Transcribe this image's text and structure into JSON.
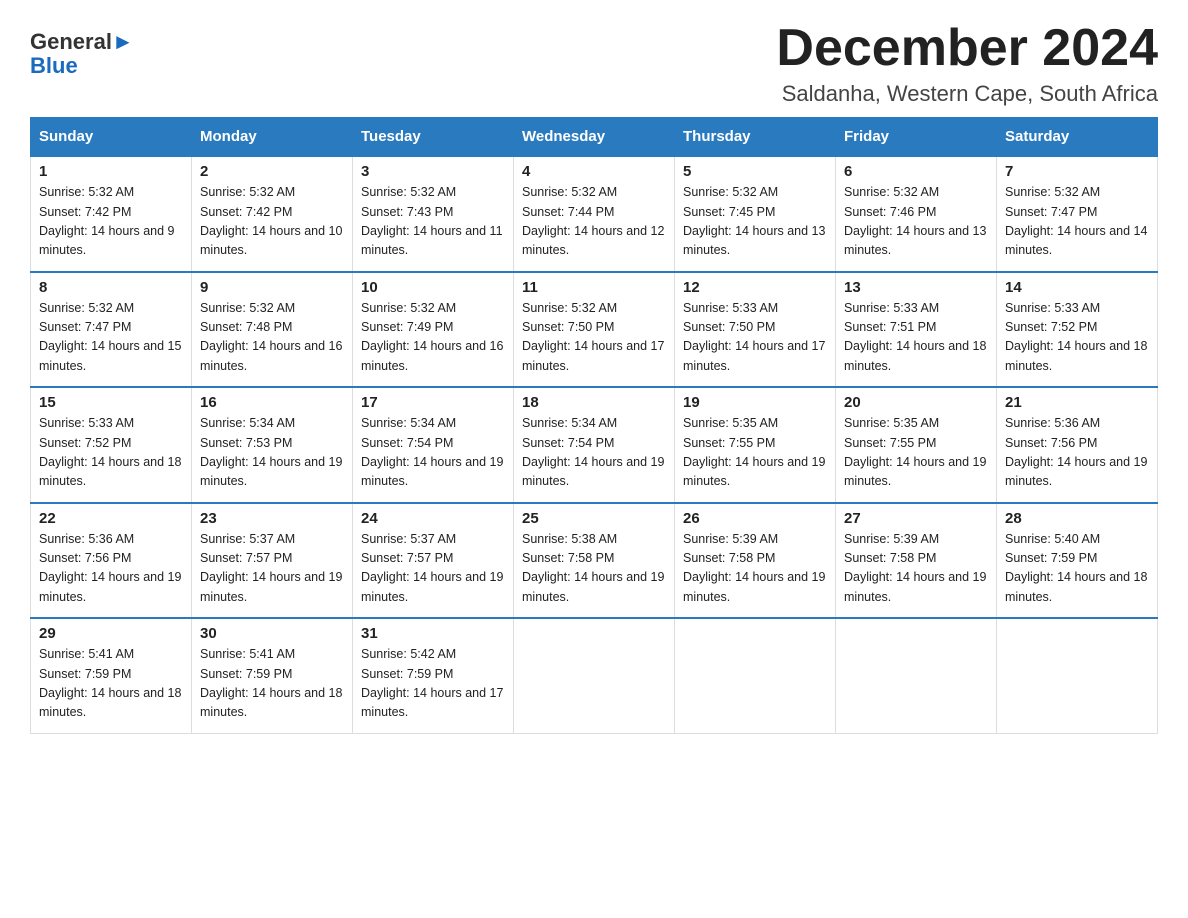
{
  "logo": {
    "line1": "General",
    "line2": "Blue"
  },
  "header": {
    "month": "December 2024",
    "location": "Saldanha, Western Cape, South Africa"
  },
  "weekdays": [
    "Sunday",
    "Monday",
    "Tuesday",
    "Wednesday",
    "Thursday",
    "Friday",
    "Saturday"
  ],
  "weeks": [
    [
      {
        "day": "1",
        "sunrise": "Sunrise: 5:32 AM",
        "sunset": "Sunset: 7:42 PM",
        "daylight": "Daylight: 14 hours and 9 minutes."
      },
      {
        "day": "2",
        "sunrise": "Sunrise: 5:32 AM",
        "sunset": "Sunset: 7:42 PM",
        "daylight": "Daylight: 14 hours and 10 minutes."
      },
      {
        "day": "3",
        "sunrise": "Sunrise: 5:32 AM",
        "sunset": "Sunset: 7:43 PM",
        "daylight": "Daylight: 14 hours and 11 minutes."
      },
      {
        "day": "4",
        "sunrise": "Sunrise: 5:32 AM",
        "sunset": "Sunset: 7:44 PM",
        "daylight": "Daylight: 14 hours and 12 minutes."
      },
      {
        "day": "5",
        "sunrise": "Sunrise: 5:32 AM",
        "sunset": "Sunset: 7:45 PM",
        "daylight": "Daylight: 14 hours and 13 minutes."
      },
      {
        "day": "6",
        "sunrise": "Sunrise: 5:32 AM",
        "sunset": "Sunset: 7:46 PM",
        "daylight": "Daylight: 14 hours and 13 minutes."
      },
      {
        "day": "7",
        "sunrise": "Sunrise: 5:32 AM",
        "sunset": "Sunset: 7:47 PM",
        "daylight": "Daylight: 14 hours and 14 minutes."
      }
    ],
    [
      {
        "day": "8",
        "sunrise": "Sunrise: 5:32 AM",
        "sunset": "Sunset: 7:47 PM",
        "daylight": "Daylight: 14 hours and 15 minutes."
      },
      {
        "day": "9",
        "sunrise": "Sunrise: 5:32 AM",
        "sunset": "Sunset: 7:48 PM",
        "daylight": "Daylight: 14 hours and 16 minutes."
      },
      {
        "day": "10",
        "sunrise": "Sunrise: 5:32 AM",
        "sunset": "Sunset: 7:49 PM",
        "daylight": "Daylight: 14 hours and 16 minutes."
      },
      {
        "day": "11",
        "sunrise": "Sunrise: 5:32 AM",
        "sunset": "Sunset: 7:50 PM",
        "daylight": "Daylight: 14 hours and 17 minutes."
      },
      {
        "day": "12",
        "sunrise": "Sunrise: 5:33 AM",
        "sunset": "Sunset: 7:50 PM",
        "daylight": "Daylight: 14 hours and 17 minutes."
      },
      {
        "day": "13",
        "sunrise": "Sunrise: 5:33 AM",
        "sunset": "Sunset: 7:51 PM",
        "daylight": "Daylight: 14 hours and 18 minutes."
      },
      {
        "day": "14",
        "sunrise": "Sunrise: 5:33 AM",
        "sunset": "Sunset: 7:52 PM",
        "daylight": "Daylight: 14 hours and 18 minutes."
      }
    ],
    [
      {
        "day": "15",
        "sunrise": "Sunrise: 5:33 AM",
        "sunset": "Sunset: 7:52 PM",
        "daylight": "Daylight: 14 hours and 18 minutes."
      },
      {
        "day": "16",
        "sunrise": "Sunrise: 5:34 AM",
        "sunset": "Sunset: 7:53 PM",
        "daylight": "Daylight: 14 hours and 19 minutes."
      },
      {
        "day": "17",
        "sunrise": "Sunrise: 5:34 AM",
        "sunset": "Sunset: 7:54 PM",
        "daylight": "Daylight: 14 hours and 19 minutes."
      },
      {
        "day": "18",
        "sunrise": "Sunrise: 5:34 AM",
        "sunset": "Sunset: 7:54 PM",
        "daylight": "Daylight: 14 hours and 19 minutes."
      },
      {
        "day": "19",
        "sunrise": "Sunrise: 5:35 AM",
        "sunset": "Sunset: 7:55 PM",
        "daylight": "Daylight: 14 hours and 19 minutes."
      },
      {
        "day": "20",
        "sunrise": "Sunrise: 5:35 AM",
        "sunset": "Sunset: 7:55 PM",
        "daylight": "Daylight: 14 hours and 19 minutes."
      },
      {
        "day": "21",
        "sunrise": "Sunrise: 5:36 AM",
        "sunset": "Sunset: 7:56 PM",
        "daylight": "Daylight: 14 hours and 19 minutes."
      }
    ],
    [
      {
        "day": "22",
        "sunrise": "Sunrise: 5:36 AM",
        "sunset": "Sunset: 7:56 PM",
        "daylight": "Daylight: 14 hours and 19 minutes."
      },
      {
        "day": "23",
        "sunrise": "Sunrise: 5:37 AM",
        "sunset": "Sunset: 7:57 PM",
        "daylight": "Daylight: 14 hours and 19 minutes."
      },
      {
        "day": "24",
        "sunrise": "Sunrise: 5:37 AM",
        "sunset": "Sunset: 7:57 PM",
        "daylight": "Daylight: 14 hours and 19 minutes."
      },
      {
        "day": "25",
        "sunrise": "Sunrise: 5:38 AM",
        "sunset": "Sunset: 7:58 PM",
        "daylight": "Daylight: 14 hours and 19 minutes."
      },
      {
        "day": "26",
        "sunrise": "Sunrise: 5:39 AM",
        "sunset": "Sunset: 7:58 PM",
        "daylight": "Daylight: 14 hours and 19 minutes."
      },
      {
        "day": "27",
        "sunrise": "Sunrise: 5:39 AM",
        "sunset": "Sunset: 7:58 PM",
        "daylight": "Daylight: 14 hours and 19 minutes."
      },
      {
        "day": "28",
        "sunrise": "Sunrise: 5:40 AM",
        "sunset": "Sunset: 7:59 PM",
        "daylight": "Daylight: 14 hours and 18 minutes."
      }
    ],
    [
      {
        "day": "29",
        "sunrise": "Sunrise: 5:41 AM",
        "sunset": "Sunset: 7:59 PM",
        "daylight": "Daylight: 14 hours and 18 minutes."
      },
      {
        "day": "30",
        "sunrise": "Sunrise: 5:41 AM",
        "sunset": "Sunset: 7:59 PM",
        "daylight": "Daylight: 14 hours and 18 minutes."
      },
      {
        "day": "31",
        "sunrise": "Sunrise: 5:42 AM",
        "sunset": "Sunset: 7:59 PM",
        "daylight": "Daylight: 14 hours and 17 minutes."
      },
      {
        "day": "",
        "sunrise": "",
        "sunset": "",
        "daylight": ""
      },
      {
        "day": "",
        "sunrise": "",
        "sunset": "",
        "daylight": ""
      },
      {
        "day": "",
        "sunrise": "",
        "sunset": "",
        "daylight": ""
      },
      {
        "day": "",
        "sunrise": "",
        "sunset": "",
        "daylight": ""
      }
    ]
  ]
}
